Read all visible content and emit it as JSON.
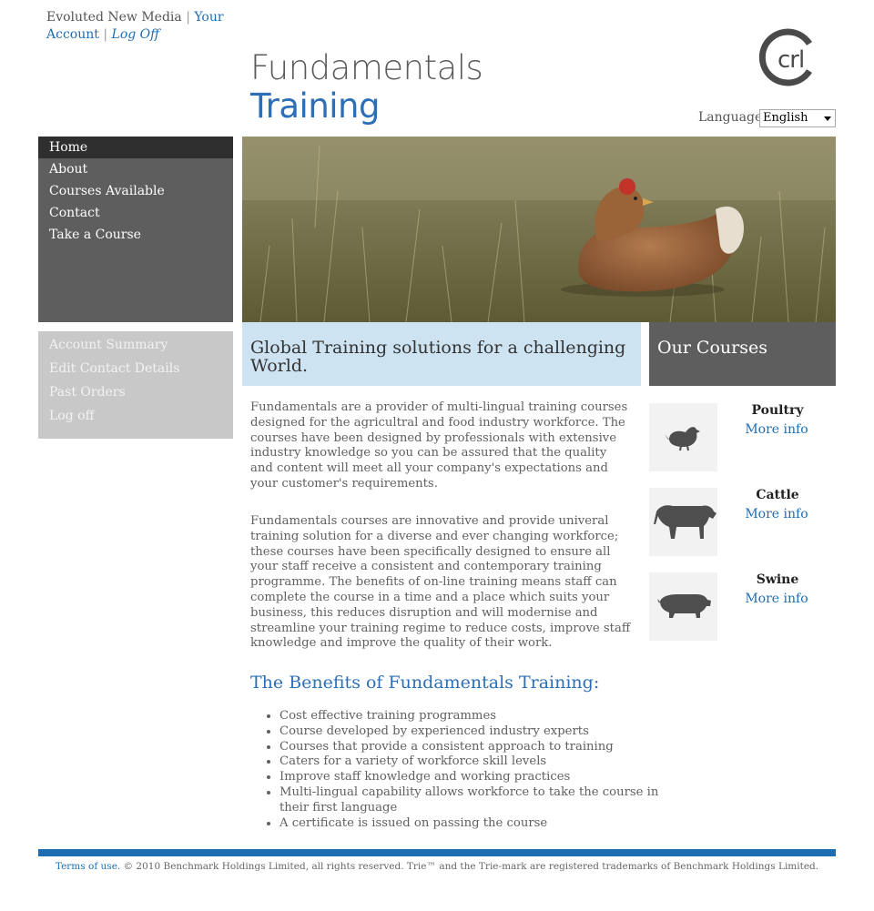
{
  "user_bar": {
    "site": "Evoluted New Media",
    "separator": "|",
    "your_account": "Your Account",
    "log_off": "Log Off"
  },
  "header": {
    "title_line1": "Fundamentals",
    "title_line2": "Training",
    "logo_text": "crl",
    "language_label": "Language",
    "language_value": "English"
  },
  "main_nav": {
    "items": [
      {
        "label": "Home"
      },
      {
        "label": "About"
      },
      {
        "label": "Courses Available"
      },
      {
        "label": "Contact"
      },
      {
        "label": "Take a Course"
      }
    ]
  },
  "account_nav": {
    "items": [
      {
        "label": "Account Summary"
      },
      {
        "label": "Edit Contact Details"
      },
      {
        "label": "Past Orders"
      },
      {
        "label": "Log off"
      }
    ]
  },
  "content": {
    "headline": "Global Training solutions for a challenging World.",
    "para1": "Fundamentals are a provider of multi-lingual training courses designed for the agricultral and food industry workforce. The courses have been designed by professionals with extensive industry knowledge so you can be assured that the quality and content will meet all your company's expectations and your customer's requirements.",
    "para2": "Fundamentals courses are innovative and provide univeral training solution for a diverse and ever changing workforce; these courses have been specifically designed to ensure all your staff receive a consistent and contemporary training programme. The benefits of on-line training means staff can complete the course in a time and a place which suits your business, this reduces disruption and will modernise and streamline your training regime to reduce costs, improve staff knowledge and improve the quality of their work.",
    "benefits_title": "The Benefits of Fundamentals Training:",
    "benefits": [
      "Cost effective training programmes",
      "Course developed by experienced industry experts",
      "Courses that provide a consistent approach to training",
      "Caters for a variety of workforce skill levels",
      "Improve staff knowledge and working practices",
      "Multi-lingual capability allows workforce to take the course in their first language",
      "A certificate is issued on passing the course"
    ]
  },
  "courses": {
    "title": "Our Courses",
    "items": [
      {
        "name": "Poultry",
        "link": "More info",
        "icon": "chicken-icon"
      },
      {
        "name": "Cattle",
        "link": "More info",
        "icon": "cow-icon"
      },
      {
        "name": "Swine",
        "link": "More info",
        "icon": "pig-icon"
      }
    ]
  },
  "footer": {
    "terms": "Terms of use.",
    "copyright": "© 2010 Benchmark Holdings Limited, all rights reserved. Trie™ and the Trie-mark are registered trademarks of Benchmark Holdings Limited."
  },
  "colors": {
    "brand_blue": "#1f6db1",
    "nav_grey": "#5e5e5e",
    "nav_active": "#2f2f2f",
    "account_grey": "#c8c8c8",
    "headline_bg": "#cde3f2"
  }
}
